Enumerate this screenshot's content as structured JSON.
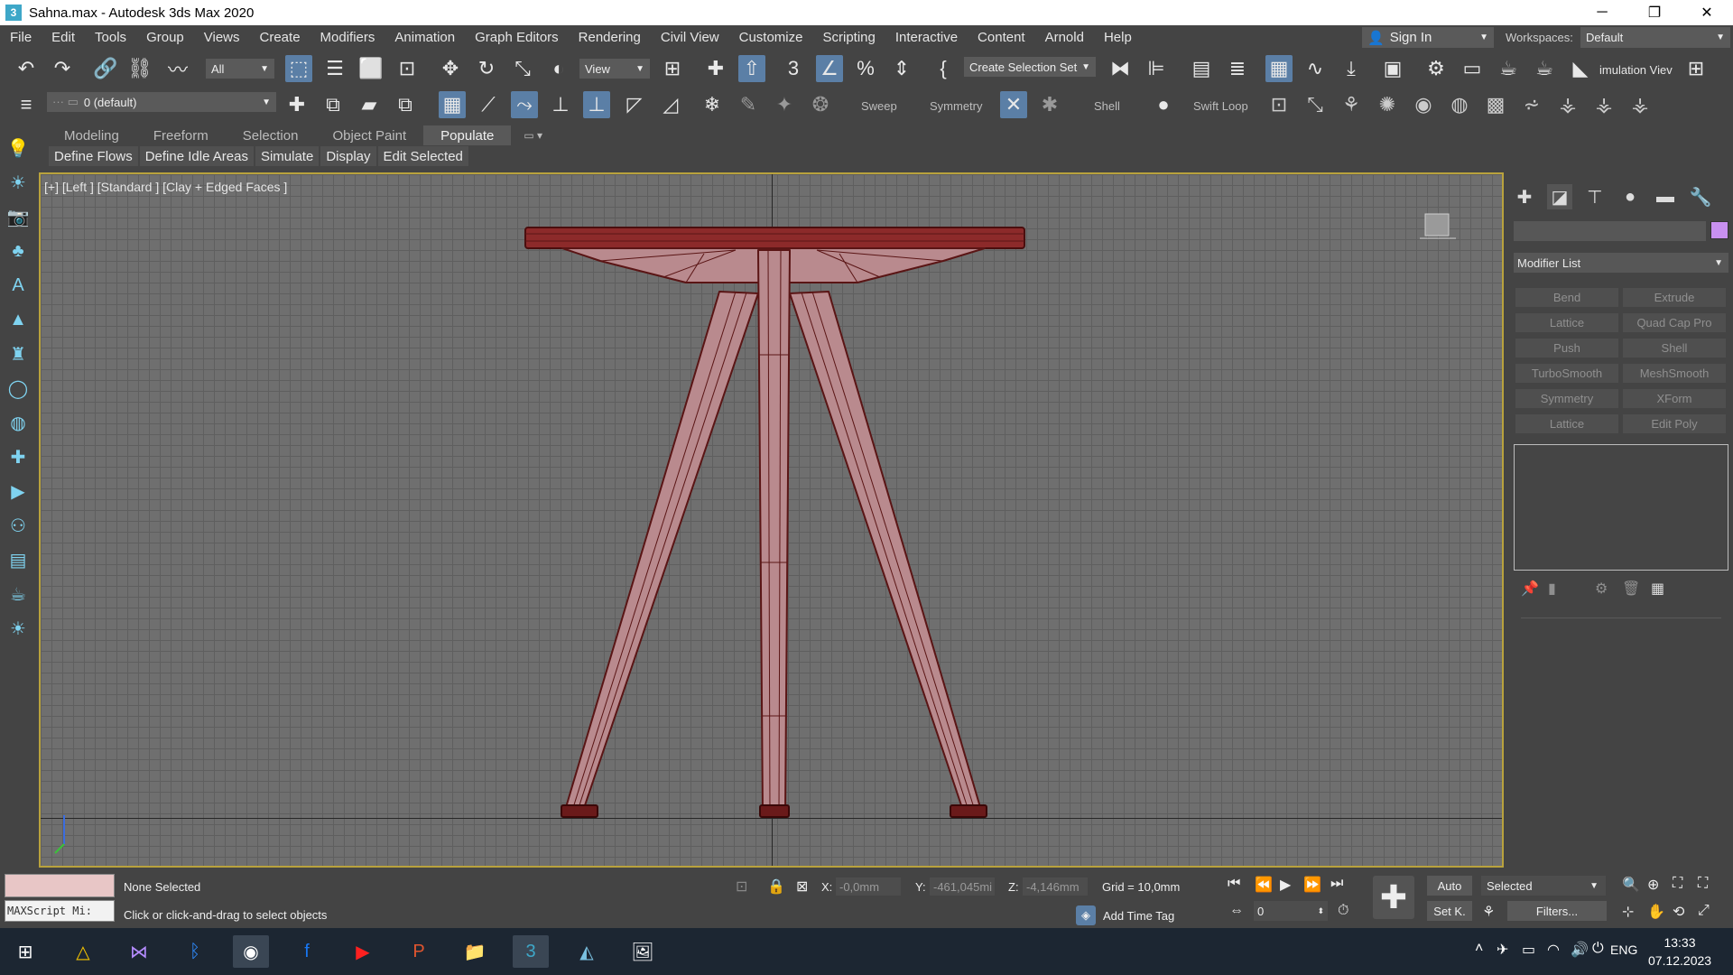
{
  "window": {
    "title": "Sahna.max - Autodesk 3ds Max 2020",
    "app_icon": "3",
    "minimize": "─",
    "restore": "❐",
    "close": "✕"
  },
  "menubar": {
    "items": [
      "File",
      "Edit",
      "Tools",
      "Group",
      "Views",
      "Create",
      "Modifiers",
      "Animation",
      "Graph Editors",
      "Rendering",
      "Civil View",
      "Customize",
      "Scripting",
      "Interactive",
      "Content",
      "Arnold",
      "Help"
    ],
    "sign_in": "Sign In",
    "workspaces_label": "Workspaces:",
    "workspace_value": "Default"
  },
  "toolbar1": {
    "filter_value": "All",
    "refcoord_value": "View",
    "selection_set_value": "Create Selection Set",
    "sim_view_label": "imulation Viev"
  },
  "toolbar2": {
    "layer_value": "0 (default)",
    "labels": {
      "sweep": "Sweep",
      "symmetry": "Symmetry",
      "shell": "Shell",
      "swift_loop": "Swift Loop"
    }
  },
  "ribbon": {
    "tabs": [
      "Modeling",
      "Freeform",
      "Selection",
      "Object Paint",
      "Populate"
    ],
    "active_tab": "Populate",
    "subtabs": [
      "Define Flows",
      "Define Idle Areas",
      "Simulate",
      "Display",
      "Edit Selected"
    ]
  },
  "viewport": {
    "label": "[+] [Left ] [Standard ] [Clay + Edged Faces ]",
    "object_color": "#b98a8e",
    "edge_color": "#5a1515",
    "nav_cube_label": "left"
  },
  "command_panel": {
    "modifier_list": "Modifier List",
    "object_color": "#c890f0",
    "modifiers": [
      "Bend",
      "Extrude",
      "Lattice",
      "Quad Cap Pro",
      "Push",
      "Shell",
      "TurboSmooth",
      "MeshSmooth",
      "Symmetry",
      "XForm",
      "Lattice",
      "Edit Poly"
    ]
  },
  "statusbar": {
    "maxscript": "MAXScript Mi:",
    "selection_status": "None Selected",
    "prompt": "Click or click-and-drag to select objects",
    "x_label": "X:",
    "x_value": "-0,0mm",
    "y_label": "Y:",
    "y_value": "-461,045mi",
    "z_label": "Z:",
    "z_value": "-4,146mm",
    "grid": "Grid = 10,0mm",
    "add_time_tag": "Add Time Tag",
    "frame_value": "0",
    "auto_key": "Auto",
    "set_key": "Set K.",
    "key_filter_value": "Selected",
    "filters": "Filters..."
  },
  "taskbar": {
    "lang": "ENG",
    "time": "13:33",
    "date": "07.12.2023"
  }
}
